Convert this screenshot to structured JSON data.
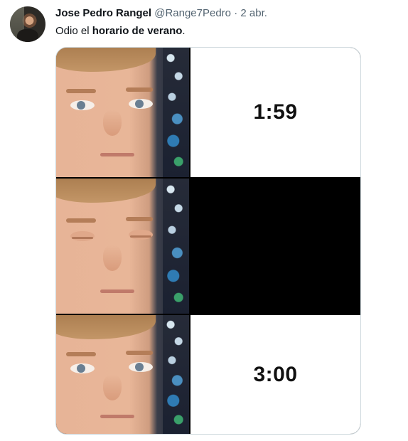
{
  "tweet": {
    "display_name": "Jose Pedro Rangel",
    "handle": "@Range7Pedro",
    "separator": "·",
    "date": "2 abr.",
    "text_prefix": "Odio el ",
    "text_bold": "horario de verano",
    "text_suffix": "."
  },
  "meme": {
    "panels": [
      {
        "time": "1:59",
        "eyes": "open"
      },
      {
        "time": "",
        "eyes": "closed"
      },
      {
        "time": "3:00",
        "eyes": "open"
      }
    ]
  },
  "colors": {
    "secondary_text": "#536471",
    "border": "#cfd9de"
  }
}
